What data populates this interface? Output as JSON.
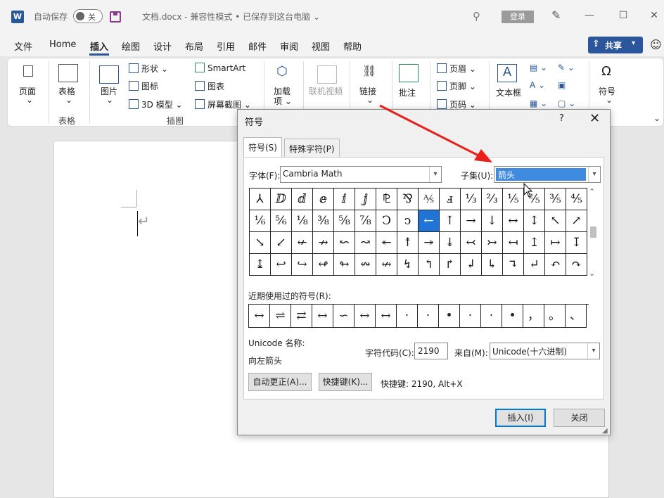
{
  "titlebar": {
    "autosave_label": "自动保存",
    "toggle_state": "关",
    "doc_title": "文档.docx  -  兼容性模式 • 已保存到这台电脑 ⌄",
    "login": "登录",
    "app_logo": "W"
  },
  "menu": {
    "items": [
      "文件",
      "Home",
      "插入",
      "绘图",
      "设计",
      "布局",
      "引用",
      "邮件",
      "审阅",
      "视图",
      "帮助"
    ],
    "active": "插入",
    "share": "共享"
  },
  "ribbon": {
    "page": "页面",
    "table": "表格",
    "table_group": "表格",
    "picture": "图片",
    "shapes": "形状 ⌄",
    "icons": "图标",
    "model3d": "3D 模型",
    "smartart": "SmartArt",
    "chart": "图表",
    "screenshot": "屏幕截图 ⌄",
    "illustrations_group": "插图",
    "addins": "加载\n项 ⌄",
    "addins_line1": "加载",
    "addins_line2": "项 ⌄",
    "online_video": "联机视频",
    "link": "链接",
    "comment": "批注",
    "header": "页眉 ⌄",
    "footer": "页脚 ⌄",
    "pagenum": "页码 ⌄",
    "textbox": "文本框",
    "symbol": "符号"
  },
  "dialog": {
    "title": "符号",
    "help": "?",
    "close": "✕",
    "tabs": [
      "符号(S)",
      "特殊字符(P)"
    ],
    "font_label": "字体(F):",
    "font_value": "Cambria Math",
    "subset_label": "子集(U):",
    "subset_value": "箭头",
    "symbols": [
      [
        "⅄",
        "ⅅ",
        "ⅆ",
        "ⅇ",
        "ⅈ",
        "ⅉ",
        "⅊",
        "⅋",
        "⅍",
        "ⅎ",
        "⅓",
        "⅔",
        "⅕",
        "⅖",
        "⅗",
        "⅘"
      ],
      [
        "⅙",
        "⅚",
        "⅛",
        "⅜",
        "⅝",
        "⅞",
        "Ↄ",
        "ↄ",
        "←",
        "↑",
        "→",
        "↓",
        "↔",
        "↕",
        "↖",
        "↗"
      ],
      [
        "↘",
        "↙",
        "↚",
        "↛",
        "↜",
        "↝",
        "↞",
        "↟",
        "↠",
        "↡",
        "↢",
        "↣",
        "↤",
        "↥",
        "↦",
        "↧"
      ],
      [
        "↨",
        "↩",
        "↪",
        "↫",
        "↬",
        "↭",
        "↮",
        "↯",
        "↰",
        "↱",
        "↲",
        "↳",
        "↴",
        "↵",
        "↶",
        "↷"
      ]
    ],
    "recent_label": "近期使用过的符号(R):",
    "recent": [
      "↔",
      "⇌",
      "⇄",
      "↔",
      "∽",
      "↔",
      "↔",
      "·",
      "·",
      "•",
      "·",
      "·",
      "•",
      "，",
      "。",
      "、"
    ],
    "unicode_name_label": "Unicode 名称:",
    "unicode_name": "向左箭头",
    "code_label": "字符代码(C):",
    "code_value": "2190",
    "from_label": "来自(M):",
    "from_value": "Unicode(十六进制)",
    "autocorrect": "自动更正(A)...",
    "shortcut_btn": "快捷键(K)...",
    "shortcut_text": "快捷键: 2190, Alt+X",
    "insert": "插入(I)",
    "close_btn": "关闭"
  },
  "colors": {
    "accent": "#2b579a",
    "selection": "#1f74d6",
    "arrow": "#e8201a"
  }
}
